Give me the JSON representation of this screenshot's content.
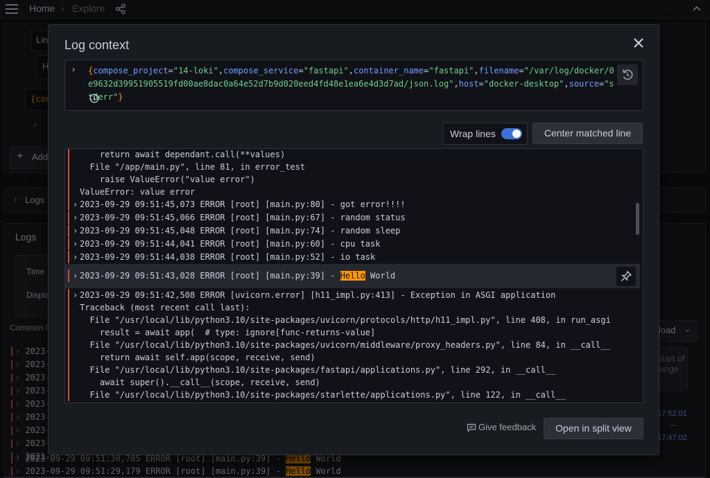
{
  "topbar": {
    "breadcrumb": [
      {
        "label": "Home"
      },
      {
        "separator": "›"
      },
      {
        "label": "Explore"
      }
    ]
  },
  "background": {
    "query_editor": {
      "label_field": "Lin",
      "label_field2": "H",
      "expr_brace": "{con",
      "add_label": "Add",
      "chevron": "›"
    },
    "logs_collapsed": "Logs",
    "logs_panel": {
      "title": "Logs",
      "time_label": "Time",
      "display_label": "Displa",
      "common_label": "Common l",
      "download_label": "load",
      "start_of_range": "Start of range",
      "time_top": "17:52:01",
      "time_dash": "—",
      "time_bottom": "17:47:02"
    },
    "log_lines": [
      {
        "text": "2023-"
      },
      {
        "text": "2023-"
      },
      {
        "text": "2023-"
      },
      {
        "text": "2023-"
      },
      {
        "text": "2023-"
      },
      {
        "text": "2023-"
      },
      {
        "text": "2023-"
      },
      {
        "text": "2023-"
      },
      {
        "text": "2023-"
      },
      {
        "text": "2023-09-29 09:51:30,785 ERROR [root] [main.py:39] - ",
        "highlight": "Hello",
        "after": " World"
      },
      {
        "text": "2023-09-29 09:51:29,179 ERROR [root] [main.py:39] - ",
        "highlight": "Hello",
        "after": " World"
      }
    ]
  },
  "modal": {
    "title": "Log context",
    "labels": {
      "open": "{",
      "close": "}",
      "pairs": [
        {
          "key": "compose_project",
          "value": "\"14-loki\""
        },
        {
          "key": "compose_service",
          "value": "\"fastapi\""
        },
        {
          "key": "container_name",
          "value": "\"fastapi\""
        },
        {
          "key": "filename",
          "value": "\"/var/log/docker/0e9632d39951905519fd00ae8dac0a64e52d7b9d020eed4fd48e1ea6e4d3d7ad/json.log\""
        },
        {
          "key": "host",
          "value": "\"docker-desktop\""
        },
        {
          "key": "source",
          "value": "\"stderr\""
        }
      ]
    },
    "wrap_lines_label": "Wrap lines",
    "wrap_lines_on": true,
    "center_matched_label": "Center matched line",
    "log_rows_before": [
      {
        "chev": "",
        "text": "    return await dependant.call(**values)"
      },
      {
        "chev": "",
        "text": "  File \"/app/main.py\", line 81, in error_test"
      },
      {
        "chev": "",
        "text": "    raise ValueError(\"value error\")"
      },
      {
        "chev": "",
        "text": "ValueError: value error"
      },
      {
        "chev": "›",
        "text": "2023-09-29 09:51:45,073 ERROR [root] [main.py:80] - got error!!!!"
      },
      {
        "chev": "›",
        "text": "2023-09-29 09:51:45,066 ERROR [root] [main.py:67] - random status"
      },
      {
        "chev": "›",
        "text": "2023-09-29 09:51:45,048 ERROR [root] [main.py:74] - random sleep"
      },
      {
        "chev": "›",
        "text": "2023-09-29 09:51:44,041 ERROR [root] [main.py:60] - cpu task"
      },
      {
        "chev": "›",
        "text": "2023-09-29 09:51:44,038 ERROR [root] [main.py:52] - io task"
      }
    ],
    "matched_row": {
      "chev": "›",
      "prefix": "2023-09-29 09:51:43,028 ERROR [root] [main.py:39] - ",
      "highlight": "Hello",
      "suffix": " World"
    },
    "log_rows_after": [
      {
        "chev": "›",
        "text": "2023-09-29 09:51:42,508 ERROR [uvicorn.error] [h11_impl.py:413] - Exception in ASGI application"
      },
      {
        "chev": "",
        "text": "Traceback (most recent call last):"
      },
      {
        "chev": "",
        "text": "  File \"/usr/local/lib/python3.10/site-packages/uvicorn/protocols/http/h11_impl.py\", line 408, in run_asgi"
      },
      {
        "chev": "",
        "text": "    result = await app(  # type: ignore[func-returns-value]"
      },
      {
        "chev": "",
        "text": "  File \"/usr/local/lib/python3.10/site-packages/uvicorn/middleware/proxy_headers.py\", line 84, in __call__"
      },
      {
        "chev": "",
        "text": "    return await self.app(scope, receive, send)"
      },
      {
        "chev": "",
        "text": "  File \"/usr/local/lib/python3.10/site-packages/fastapi/applications.py\", line 292, in __call__"
      },
      {
        "chev": "",
        "text": "    await super().__call__(scope, receive, send)"
      },
      {
        "chev": "",
        "text": "  File \"/usr/local/lib/python3.10/site-packages/starlette/applications.py\", line 122, in __call__"
      }
    ],
    "give_feedback_label": "Give feedback",
    "split_view_label": "Open in split view"
  },
  "colors": {
    "error_bar": "#d44a3a",
    "highlight": "#ff9900",
    "label_key": "#6e9fff",
    "label_value": "#6ccf8e",
    "toggle_on": "#3d71d9"
  }
}
